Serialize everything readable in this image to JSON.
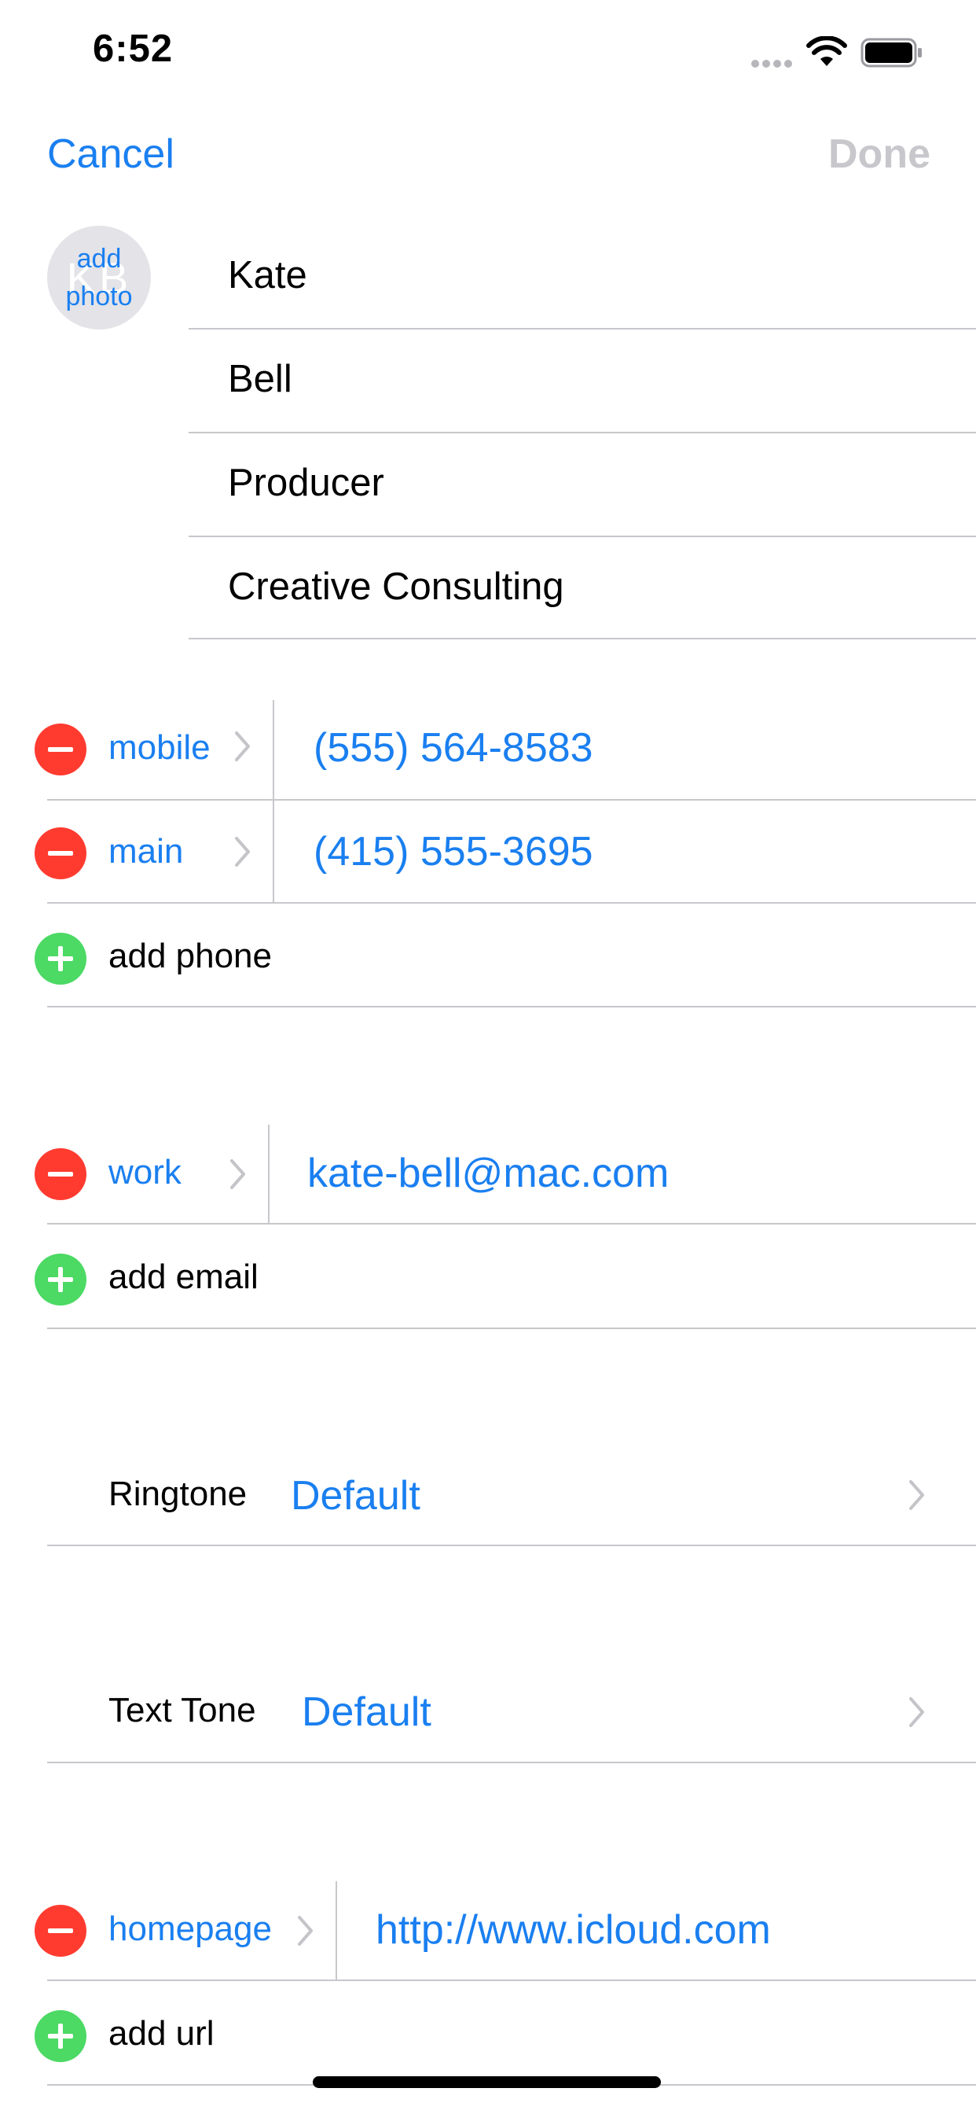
{
  "status_bar": {
    "time": "6:52"
  },
  "nav": {
    "cancel": "Cancel",
    "done": "Done"
  },
  "avatar": {
    "initials": "KB",
    "add_photo_line1": "add",
    "add_photo_line2": "photo"
  },
  "name_fields": {
    "first_name": "Kate",
    "last_name": "Bell",
    "job_title": "Producer",
    "company": "Creative Consulting"
  },
  "phones": [
    {
      "label": "mobile",
      "value": "(555) 564-8583"
    },
    {
      "label": "main",
      "value": "(415) 555-3695"
    }
  ],
  "add_phone": "add phone",
  "emails": [
    {
      "label": "work",
      "value": "kate-bell@mac.com"
    }
  ],
  "add_email": "add email",
  "ringtone": {
    "label": "Ringtone",
    "value": "Default"
  },
  "text_tone": {
    "label": "Text Tone",
    "value": "Default"
  },
  "urls": [
    {
      "label": "homepage",
      "value": "http://www.icloud.com"
    }
  ],
  "add_url": "add url",
  "colors": {
    "accent": "#1a7ff0",
    "delete": "#ff3b30",
    "add": "#4cd964",
    "disabled": "#c7c7cc",
    "separator": "#c8c7cc"
  },
  "icons": [
    "signal-dots-icon",
    "wifi-icon",
    "battery-icon",
    "remove-circle-icon",
    "add-circle-icon",
    "chevron-right-icon"
  ]
}
